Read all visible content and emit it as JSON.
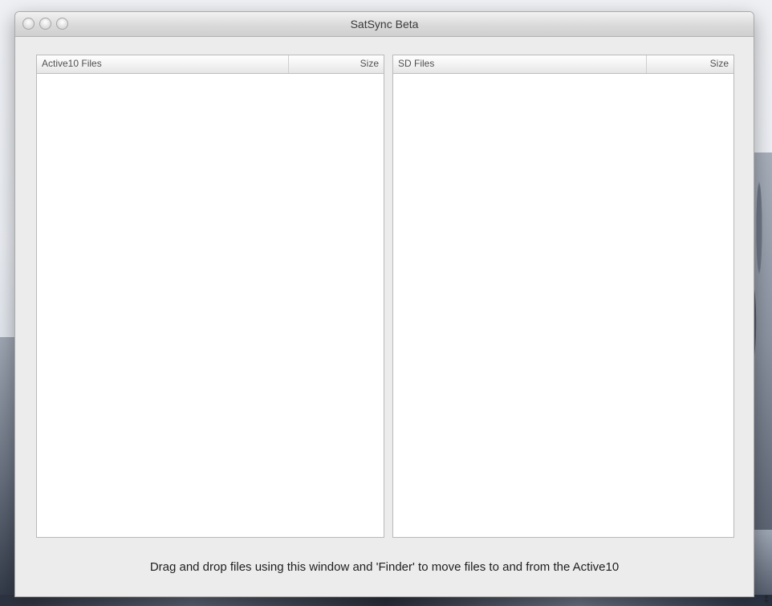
{
  "window": {
    "title": "SatSync Beta"
  },
  "left_table": {
    "columns": [
      "Active10 Files",
      "Size"
    ],
    "rows": []
  },
  "right_table": {
    "columns": [
      "SD Files",
      "Size"
    ],
    "rows": []
  },
  "footer": {
    "instructions": "Drag and drop files using this window and 'Finder' to move files to and from the Active10"
  },
  "desktop": {
    "corner_glyph": "‡"
  },
  "colors": {
    "window_bg": "#ececec",
    "table_bg": "#ffffff",
    "border": "#b9b9b9"
  }
}
